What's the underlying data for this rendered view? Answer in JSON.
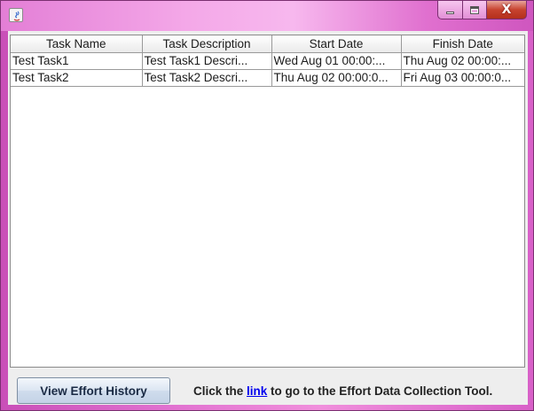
{
  "window": {
    "title": "",
    "controls": {
      "minimize_icon": "minimize-icon",
      "maximize_icon": "maximize-icon",
      "close_icon": "close-icon",
      "close_glyph": "X"
    }
  },
  "table": {
    "columns": [
      "Task Name",
      "Task Description",
      "Start Date",
      "Finish Date"
    ],
    "rows": [
      [
        "Test Task1",
        "Test Task1 Descri...",
        "Wed Aug 01 00:00:...",
        "Thu Aug 02 00:00:..."
      ],
      [
        "Test Task2",
        "Test Task2 Descri...",
        "Thu Aug 02 00:00:0...",
        "Fri Aug 03 00:00:0..."
      ]
    ]
  },
  "footer": {
    "button_label": "View Effort History",
    "hint_prefix": "Click the ",
    "hint_link": "link",
    "hint_suffix": " to go to the Effort Data Collection Tool."
  },
  "colors": {
    "titlebar_accent": "#e070cf",
    "link": "#0000ee",
    "close_button": "#c7432f"
  }
}
